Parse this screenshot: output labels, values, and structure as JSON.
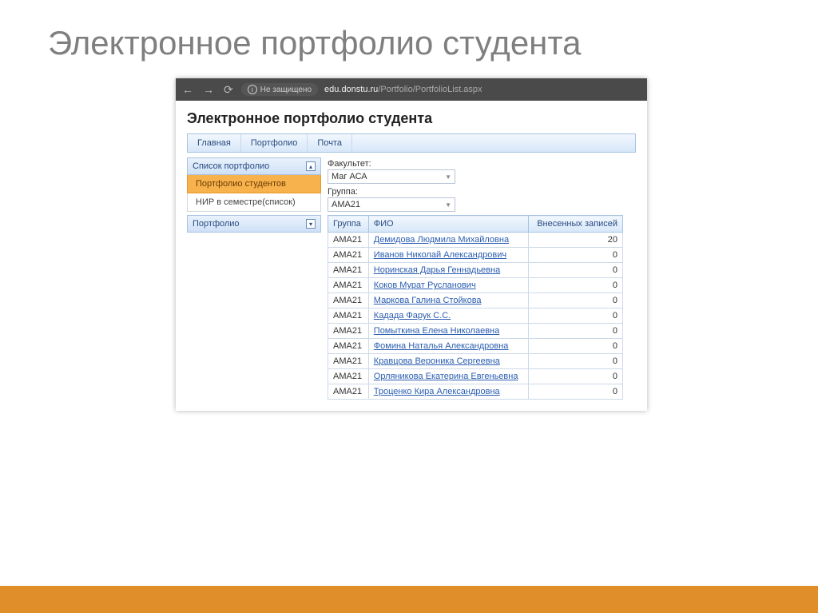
{
  "slide_title": "Электронное портфолио студента",
  "browser": {
    "insecure_label": "Не защищено",
    "url_host": "edu.donstu.ru",
    "url_path": "/Portfolio/PortfolioList.aspx"
  },
  "page": {
    "heading": "Электронное портфолио студента",
    "menu": {
      "home": "Главная",
      "portfolio": "Портфолио",
      "mail": "Почта"
    },
    "sidebar": {
      "header1": "Список портфолио",
      "item_active": "Портфолио студентов",
      "item_nir": "НИР в семестре(список)",
      "header2": "Портфолио"
    },
    "filters": {
      "faculty_label": "Факультет:",
      "faculty_value": "Маг АСА",
      "group_label": "Группа:",
      "group_value": "АМА21"
    },
    "table": {
      "col_group": "Группа",
      "col_fio": "ФИО",
      "col_count": "Внесенных записей",
      "rows": [
        {
          "group": "АМА21",
          "fio": "Демидова Людмила Михайловна",
          "count": "20"
        },
        {
          "group": "АМА21",
          "fio": "Иванов Николай Александрович",
          "count": "0"
        },
        {
          "group": "АМА21",
          "fio": "Норинская Дарья Геннадьевна",
          "count": "0"
        },
        {
          "group": "АМА21",
          "fio": "Коков Мурат Русланович",
          "count": "0"
        },
        {
          "group": "АМА21",
          "fio": "Маркова Галина Стойкова",
          "count": "0"
        },
        {
          "group": "АМА21",
          "fio": "Кадада Фарук С.С.",
          "count": "0"
        },
        {
          "group": "АМА21",
          "fio": "Помыткина Елена Николаевна",
          "count": "0"
        },
        {
          "group": "АМА21",
          "fio": "Фомина Наталья Александровна",
          "count": "0"
        },
        {
          "group": "АМА21",
          "fio": "Кравцова Вероника Сергеевна",
          "count": "0"
        },
        {
          "group": "АМА21",
          "fio": "Орляникова Екатерина Евгеньевна",
          "count": "0"
        },
        {
          "group": "АМА21",
          "fio": "Троценко Кира Александровна",
          "count": "0"
        }
      ]
    }
  }
}
